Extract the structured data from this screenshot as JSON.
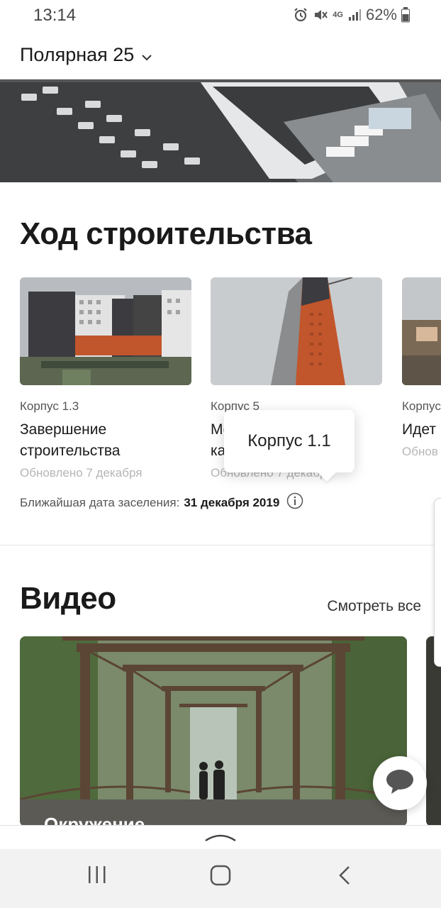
{
  "status_bar": {
    "time": "13:14",
    "battery": "62%",
    "network": "4G"
  },
  "header": {
    "project_name": "Полярная 25"
  },
  "progress": {
    "title": "Ход строительства",
    "cards": [
      {
        "building": "Корпус 1.3",
        "status": "Завершение строительства",
        "updated": "Обновлено 7 декабря"
      },
      {
        "building": "Корпус 5",
        "status": "Монтаж фасада и каркаса",
        "updated": "Обновлено 7 декабря"
      },
      {
        "building": "Корпус",
        "status": "Идет",
        "updated": "Обнов"
      }
    ],
    "settlement_label": "Ближайшая дата заселения:",
    "settlement_date": "31 декабря 2019"
  },
  "tooltip": {
    "text": "Корпус 1.1"
  },
  "video": {
    "title": "Видео",
    "see_all": "Смотреть все",
    "items": [
      {
        "caption": "Окружение"
      }
    ]
  },
  "colors": {
    "brick": "#c1552b",
    "dark_facade": "#3b3b40",
    "nav_bg": "#f2f2f2"
  }
}
